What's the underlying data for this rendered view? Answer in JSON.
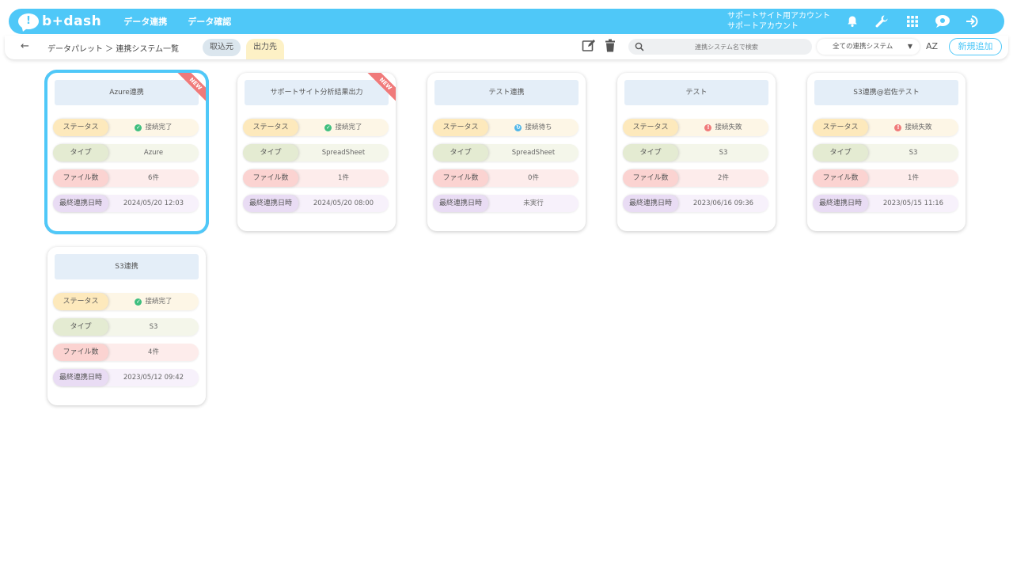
{
  "app": {
    "logo_mark": "!",
    "logo_text": "b+dash"
  },
  "nav": [
    "データ連携",
    "データ確認"
  ],
  "account": {
    "line1": "サポートサイト用アカウント",
    "line2": "サポートアカウント"
  },
  "header_icons": [
    "bell-icon",
    "wrench-icon",
    "grid-icon",
    "assistant-icon",
    "logout-icon"
  ],
  "breadcrumb": "データパレット ＞ 連携システム一覧",
  "tabs": {
    "import": "取込元",
    "export": "出力先"
  },
  "search": {
    "placeholder": "連携システム名で検索"
  },
  "filter": {
    "selected": "全ての連携システム"
  },
  "sort_label": "AZ",
  "new_button": "新規追加",
  "labels": {
    "status": "ステータス",
    "type": "タイプ",
    "files": "ファイル数",
    "last": "最終連携日時"
  },
  "badge": "NEW",
  "colors": {
    "accent": "#4fc8f8",
    "ok": "#3fbf7f",
    "waiting": "#4fb6e8",
    "error": "#f07a7a"
  },
  "cards": [
    {
      "title": "Azure連携",
      "status": "接続完了",
      "status_kind": "ok",
      "type": "Azure",
      "files": "6件",
      "last": "2024/05/20 12:03",
      "is_new": true,
      "selected": true
    },
    {
      "title": "サポートサイト分析結果出力",
      "status": "接続完了",
      "status_kind": "ok",
      "type": "SpreadSheet",
      "files": "1件",
      "last": "2024/05/20 08:00",
      "is_new": true,
      "selected": false
    },
    {
      "title": "テスト連携",
      "status": "接続待ち",
      "status_kind": "waiting",
      "type": "SpreadSheet",
      "files": "0件",
      "last": "未実行",
      "is_new": false,
      "selected": false
    },
    {
      "title": "テスト",
      "status": "接続失敗",
      "status_kind": "error",
      "type": "S3",
      "files": "2件",
      "last": "2023/06/16 09:36",
      "is_new": false,
      "selected": false
    },
    {
      "title": "S3連携@岩佐テスト",
      "status": "接続失敗",
      "status_kind": "error",
      "type": "S3",
      "files": "1件",
      "last": "2023/05/15 11:16",
      "is_new": false,
      "selected": false
    },
    {
      "title": "S3連携",
      "status": "接続完了",
      "status_kind": "ok",
      "type": "S3",
      "files": "4件",
      "last": "2023/05/12 09:42",
      "is_new": false,
      "selected": false
    }
  ]
}
